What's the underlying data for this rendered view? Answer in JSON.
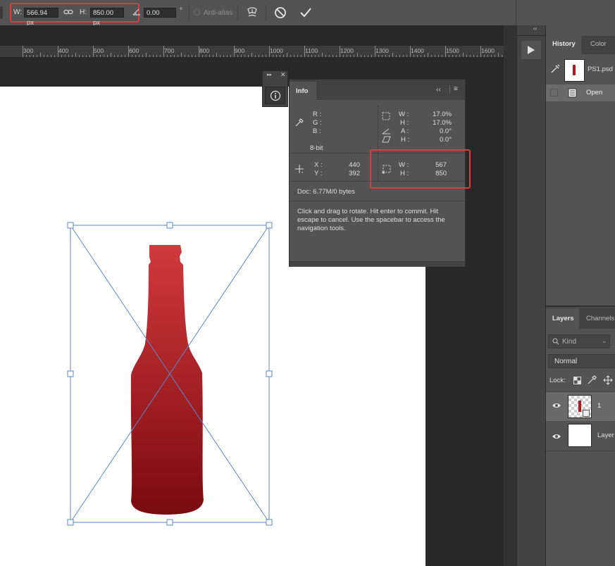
{
  "options_bar": {
    "w_label": "W:",
    "w_value": "566.94 px",
    "h_label": "H:",
    "h_value": "850.00 px",
    "angle_value": "0.00",
    "degree": "°",
    "antialias_label": "Anti-alias"
  },
  "ruler": {
    "ticks": [
      "300",
      "400",
      "500",
      "600",
      "700",
      "800",
      "900",
      "1000",
      "1100",
      "1200",
      "1300",
      "1400",
      "1500",
      "1600"
    ]
  },
  "info_panel": {
    "tab": "Info",
    "rgb": [
      "R :",
      "G :",
      "B :"
    ],
    "bit_depth": "8-bit",
    "transform": {
      "w_label": "W :",
      "w_value": "17.0%",
      "h_label": "H :",
      "h_value": "17.0%",
      "a_label": "A :",
      "a_value": "0.0°",
      "skew_label": "H :",
      "skew_value": "0.0°"
    },
    "pos": {
      "x_label": "X :",
      "x_value": "440",
      "y_label": "Y :",
      "y_value": "392"
    },
    "size": {
      "w_label": "W :",
      "w_value": "567",
      "h_label": "H :",
      "h_value": "850"
    },
    "doc_label": "Doc: 6.77M/0 bytes",
    "help": "Click and drag to rotate. Hit enter to commit. Hit escape to cancel. Use the spacebar to access the navigation tools."
  },
  "history_panel": {
    "tabs": [
      "History",
      "Color"
    ],
    "snapshot_name": "PS1.psd",
    "items": [
      "Open"
    ]
  },
  "layers_panel": {
    "tabs": [
      "Layers",
      "Channels"
    ],
    "filter_placeholder": "Kind",
    "blend_mode": "Normal",
    "lock_label": "Lock:",
    "layers": [
      {
        "name": "1",
        "type": "smart-object"
      },
      {
        "name": "Layer",
        "type": "white-fill"
      }
    ]
  },
  "colors": {
    "accent_red": "#e03b3b",
    "bottle_top": "#d23a3c",
    "bottle_bottom": "#7a0a10",
    "bbox_blue": "#5b87c9"
  }
}
